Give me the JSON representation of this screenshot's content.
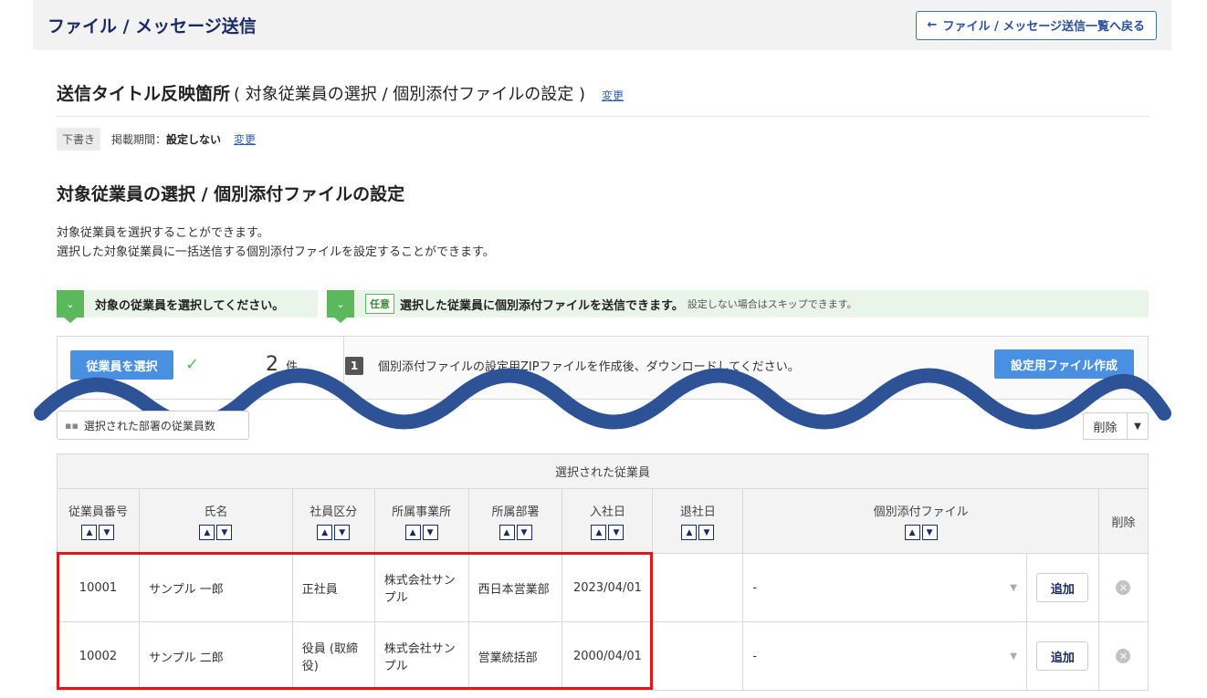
{
  "header": {
    "title": "ファイル / メッセージ送信",
    "back_label": "ファイル / メッセージ送信一覧へ戻る"
  },
  "message": {
    "title_strong": "送信タイトル反映箇所",
    "title_paren": "( 対象従業員の選択 / 個別添付ファイルの設定 )",
    "change_label": "変更"
  },
  "status": {
    "draft": "下書き",
    "period_label": "掲載期間：",
    "period_value": "設定しない",
    "change_label": "変更"
  },
  "section": {
    "title": "対象従業員の選択 / 個別添付ファイルの設定",
    "desc1": "対象従業員を選択することができます。",
    "desc2": "選択した対象従業員に一括送信する個別添付ファイルを設定することができます。"
  },
  "steps": {
    "step1": "対象の従業員を選択してください。",
    "optional_badge": "任意",
    "step2": "選択した従業員に個別添付ファイルを送信できます。",
    "step2_note": "設定しない場合はスキップできます。"
  },
  "panel": {
    "select_button": "従業員を選択",
    "count": "2",
    "count_unit": "件",
    "step_number": "1",
    "zip_text": "個別添付ファイルの設定用ZIPファイルを作成後、ダウンロードしてください。",
    "create_button": "設定用ファイル作成"
  },
  "toolbar": {
    "dept_button": "選択された部署の従業員数",
    "delete_label": "削除"
  },
  "table": {
    "group_header": "選択された従業員",
    "columns": [
      "従業員番号",
      "氏名",
      "社員区分",
      "所属事業所",
      "所属部署",
      "入社日",
      "退社日",
      "個別添付ファイル",
      "削除"
    ],
    "rows": [
      {
        "id": "10001",
        "name": "サンプル 一郎",
        "type": "正社員",
        "office": "株式会社サンプル",
        "dept": "西日本営業部",
        "hired": "2023/04/01",
        "left": "",
        "file": "-",
        "add": "追加"
      },
      {
        "id": "10002",
        "name": "サンプル 二郎",
        "type": "役員 (取締役)",
        "office": "株式会社サンプル",
        "dept": "営業統括部",
        "hired": "2000/04/01",
        "left": "",
        "file": "-",
        "add": "追加"
      }
    ]
  },
  "colors": {
    "navy": "#1a2a66",
    "accent_blue": "#4a90e2",
    "green": "#5cb85c",
    "wave": "#2d5296",
    "highlight_red": "#e01818"
  }
}
